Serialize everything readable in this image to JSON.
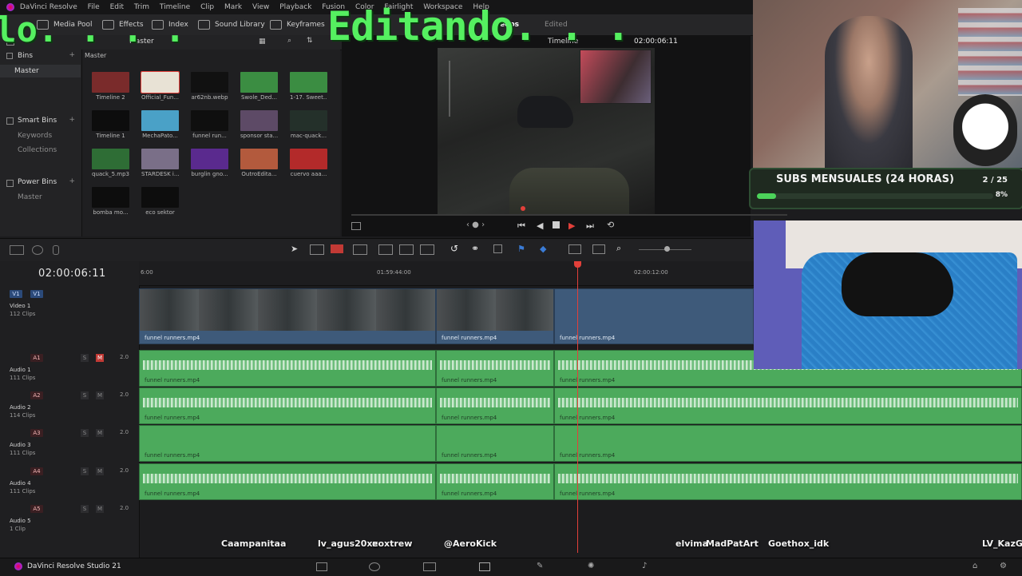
{
  "app": {
    "name": "DaVinci Resolve",
    "footer_name": "DaVinci Resolve Studio 21"
  },
  "menu": [
    "DaVinci Resolve",
    "File",
    "Edit",
    "Trim",
    "Timeline",
    "Clip",
    "Mark",
    "View",
    "Playback",
    "Fusion",
    "Color",
    "Fairlight",
    "Workspace",
    "Help"
  ],
  "toolbar": {
    "media_pool": "Media Pool",
    "effects": "Effects",
    "index": "Index",
    "sound_library": "Sound Library",
    "keyframes": "Keyframes",
    "project_fragment": "eeps",
    "edited": "Edited"
  },
  "pool_header": {
    "bin_label": "Master",
    "breadcrumb": "Master"
  },
  "viewer": {
    "timeline_label": "Timeline",
    "timecode": "02:00:06:11"
  },
  "sidebar": {
    "bins": "Bins",
    "master": "Master",
    "smart_bins": "Smart Bins",
    "keywords": "Keywords",
    "collections": "Collections",
    "power_bins": "Power Bins",
    "power_master": "Master"
  },
  "clips": [
    {
      "label": "Timeline 2",
      "color": "#7a2b2b"
    },
    {
      "label": "Official_Fun...",
      "color": "#e8e2d5"
    },
    {
      "label": "ar62nb.webp",
      "color": "#111111"
    },
    {
      "label": "Swole_Ded...",
      "color": "#3b8d42"
    },
    {
      "label": "1-17. Sweet...",
      "color": "#3b8d42"
    },
    {
      "label": "Timeline 1",
      "color": "#0d0d0d"
    },
    {
      "label": "MechaPato...",
      "color": "#4aa1c7"
    },
    {
      "label": "funnel run...",
      "color": "#0f0f0f"
    },
    {
      "label": "sponsor sta...",
      "color": "#5d4a66"
    },
    {
      "label": "mac-quack...",
      "color": "#24302a"
    },
    {
      "label": "quack_5.mp3",
      "color": "#2e6d35"
    },
    {
      "label": "STARDESK i...",
      "color": "#7a6f88"
    },
    {
      "label": "burglin gno...",
      "color": "#5a2a8e"
    },
    {
      "label": "OutroEdita...",
      "color": "#b35a3d"
    },
    {
      "label": "cuervo aaa...",
      "color": "#b32a2a"
    },
    {
      "label": "bomba mo...",
      "color": "#0d0d0d"
    },
    {
      "label": "eco sektor",
      "color": "#0d0d0d"
    }
  ],
  "overlay": {
    "left": "lo. . . .",
    "title": "Editando. . ."
  },
  "subs_widget": {
    "title": "SUBS MENSUALES (24 HORAS)",
    "count": "2 / 25",
    "percent": "8%",
    "progress": 0.08
  },
  "timeline": {
    "timecode": "02:00:06:11",
    "ruler": [
      "6:00",
      "01:59:44:00",
      "02:00:12:00"
    ],
    "tracks": [
      {
        "id": "V1",
        "name": "Video 1",
        "count": "112 Clips",
        "level": ""
      },
      {
        "id": "A1",
        "name": "Audio 1",
        "count": "111 Clips",
        "level": "2.0"
      },
      {
        "id": "A2",
        "name": "Audio 2",
        "count": "114 Clips",
        "level": "2.0"
      },
      {
        "id": "A3",
        "name": "Audio 3",
        "count": "111 Clips",
        "level": "2.0"
      },
      {
        "id": "A4",
        "name": "Audio 4",
        "count": "111 Clips",
        "level": "2.0"
      },
      {
        "id": "A5",
        "name": "Audio 5",
        "count": "1 Clip",
        "level": "2.0"
      }
    ],
    "clip_name": "funnel runners.mp4"
  },
  "chat_names": [
    "Caampanitaa",
    "lv_agus20xx",
    "eoxtrew",
    "@AeroKick",
    "elvima",
    "MadPatArt",
    "Goethox_idk",
    "LV_KazGM"
  ],
  "colors": {
    "accent_green": "#55f060",
    "audio_green": "#4caa5c",
    "video_blue": "#3e5a7a",
    "playhead": "#e2403a"
  }
}
